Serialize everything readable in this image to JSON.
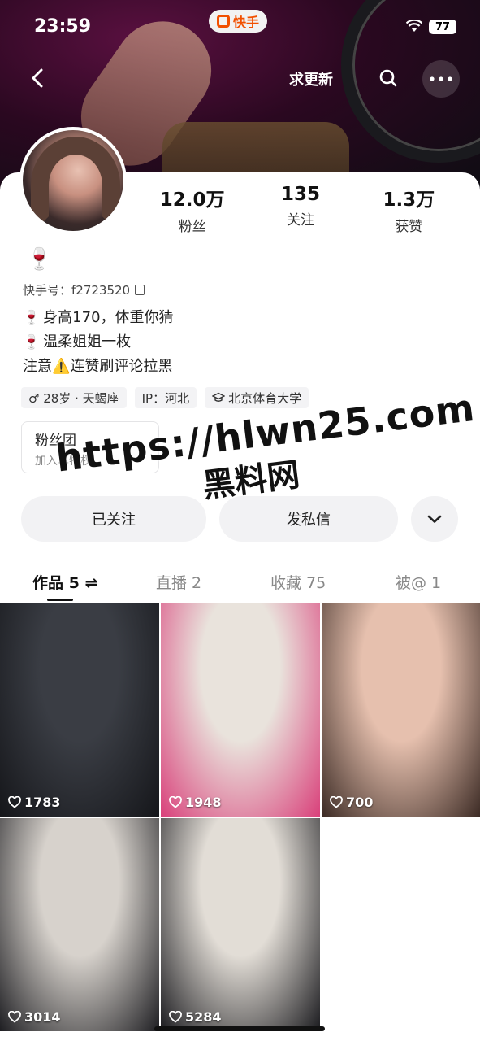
{
  "status_bar": {
    "time": "23:59",
    "battery": "77"
  },
  "app_pill": {
    "label": "快手"
  },
  "top_nav": {
    "update_label": "求更新"
  },
  "stats": [
    {
      "value": "12.0万",
      "label": "粉丝"
    },
    {
      "value": "135",
      "label": "关注"
    },
    {
      "value": "1.3万",
      "label": "获赞"
    }
  ],
  "profile": {
    "name_emoji": "🍷",
    "kuaishou_id": "快手号：f2723520",
    "bio": [
      {
        "emoji": "🍷",
        "text": "身高170，体重你猜"
      },
      {
        "emoji": "🍷",
        "text": "温柔姐姐一枚"
      },
      {
        "emoji": "",
        "text": "注意⚠️连赞刷评论拉黑"
      }
    ],
    "tags": [
      "♂ 28岁 · 天蝎座",
      "IP：河北",
      "北京体育大学"
    ]
  },
  "fan_club": {
    "title": "粉丝团",
    "subtitle": "加入享特权"
  },
  "actions": {
    "follow": "已关注",
    "message": "发私信"
  },
  "watermark": {
    "url": "https://hlwn25.com",
    "sub": "黑料网"
  },
  "tabs": [
    {
      "label": "作品 5 ⇌",
      "active": true
    },
    {
      "label": "直播 2",
      "active": false
    },
    {
      "label": "收藏 75",
      "active": false
    },
    {
      "label": "被@ 1",
      "active": false
    }
  ],
  "videos": [
    {
      "likes": "1783",
      "colors": [
        "#3a3d44",
        "#15161a"
      ]
    },
    {
      "likes": "1948",
      "colors": [
        "#e9e3dc",
        "#d9407a"
      ]
    },
    {
      "likes": "700",
      "colors": [
        "#e6c0ae",
        "#3b2a24"
      ]
    },
    {
      "likes": "3014",
      "colors": [
        "#d7d2cc",
        "#1e1e22"
      ]
    },
    {
      "likes": "5284",
      "colors": [
        "#e2ddd6",
        "#1a1a1e"
      ]
    }
  ]
}
